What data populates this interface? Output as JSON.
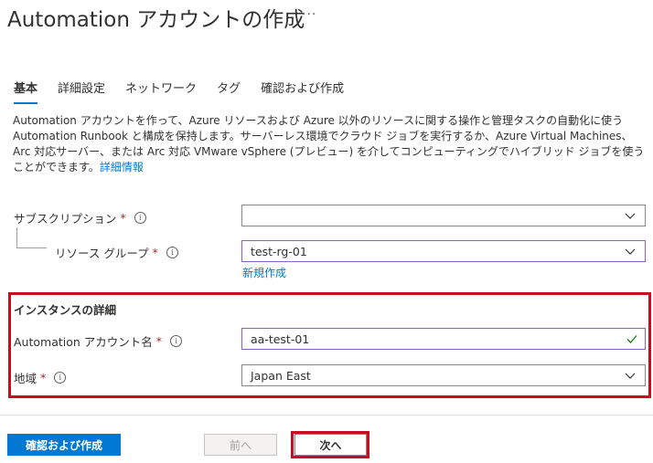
{
  "header": {
    "title": "Automation アカウントの作成",
    "more": "···"
  },
  "tabs": [
    {
      "label": "基本",
      "active": true
    },
    {
      "label": "詳細設定"
    },
    {
      "label": "ネットワーク"
    },
    {
      "label": "タグ"
    },
    {
      "label": "確認および作成"
    }
  ],
  "description": {
    "text": "Automation アカウントを作って、Azure リソースおよび Azure 以外のリソースに関する操作と管理タスクの自動化に使う Automation Runbook と構成を保持します。サーバーレス環境でクラウド ジョブを実行するか、Azure Virtual Machines、Arc 対応サーバー、または Arc 対応 VMware vSphere (プレビュー) を介してコンピューティングでハイブリッド ジョブを使うことができます。",
    "link": "詳細情報"
  },
  "form": {
    "subscription": {
      "label": "サブスクリプション",
      "value": ""
    },
    "resource_group": {
      "label": "リソース グループ",
      "value": "test-rg-01",
      "new_link": "新規作成"
    },
    "instance_section": "インスタンスの詳細",
    "account_name": {
      "label": "Automation アカウント名",
      "value": "aa-test-01"
    },
    "region": {
      "label": "地域",
      "value": "Japan East"
    },
    "required_mark": "*",
    "info_glyph": "i"
  },
  "footer": {
    "review_create": "確認および作成",
    "prev": "前へ",
    "next": "次へ"
  },
  "colors": {
    "accent": "#0078d4",
    "highlight": "#c50f1f",
    "required": "#a4262c",
    "valid": "#107c10"
  }
}
